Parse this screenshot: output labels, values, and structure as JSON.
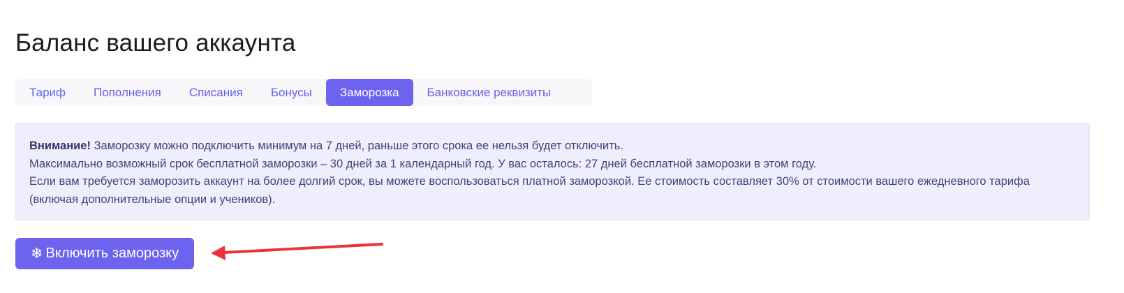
{
  "page": {
    "title": "Баланс вашего аккаунта"
  },
  "tabs": [
    {
      "label": "Тариф",
      "active": false
    },
    {
      "label": "Пополнения",
      "active": false
    },
    {
      "label": "Списания",
      "active": false
    },
    {
      "label": "Бонусы",
      "active": false
    },
    {
      "label": "Заморозка",
      "active": true
    },
    {
      "label": "Банковские реквизиты",
      "active": false
    }
  ],
  "alert": {
    "strong": "Внимание!",
    "line1": " Заморозку можно подключить минимум на 7 дней, раньше этого срока ее нельзя будет отключить.",
    "line2": "Максимально возможный срок бесплатной заморозки – 30 дней за 1 календарный год. У вас осталось: 27 дней бесплатной заморозки в этом году.",
    "line3": "Если вам требуется заморозить аккаунт на более долгий срок, вы можете воспользоваться платной заморозкой. Ее стоимость составляет 30% от стоимости вашего ежедневного тарифа (включая дополнительные опции и учеников)."
  },
  "freeze_button": {
    "icon": "snowflake-icon",
    "icon_glyph": "❄",
    "label": "Включить заморозку"
  },
  "annotation": {
    "arrow_color": "#e8343a"
  },
  "colors": {
    "accent": "#6c63ef",
    "tab_text": "#6860ee",
    "alert_bg": "#efeefd",
    "alert_text": "#42417a"
  }
}
